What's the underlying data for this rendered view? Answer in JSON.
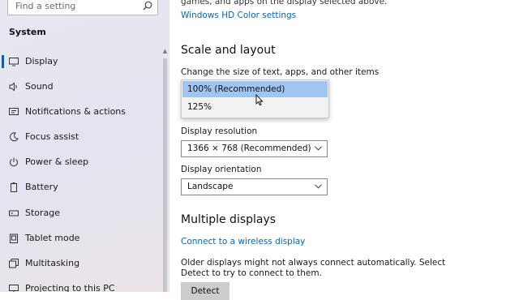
{
  "sidebar": {
    "search_placeholder": "Find a setting",
    "section_title": "System",
    "items": [
      {
        "label": "Display",
        "icon": "monitor-icon"
      },
      {
        "label": "Sound",
        "icon": "speaker-icon"
      },
      {
        "label": "Notifications & actions",
        "icon": "notifications-icon"
      },
      {
        "label": "Focus assist",
        "icon": "moon-icon"
      },
      {
        "label": "Power & sleep",
        "icon": "power-icon"
      },
      {
        "label": "Battery",
        "icon": "battery-icon"
      },
      {
        "label": "Storage",
        "icon": "storage-icon"
      },
      {
        "label": "Tablet mode",
        "icon": "tablet-icon"
      },
      {
        "label": "Multitasking",
        "icon": "multitasking-icon"
      },
      {
        "label": "Projecting to this PC",
        "icon": "projecting-icon"
      }
    ],
    "active_index": 0
  },
  "main": {
    "top_text": "games, and apps on the display selected above.",
    "hd_color_link": "Windows HD Color settings",
    "scale_heading": "Scale and layout",
    "scale_label": "Change the size of text, apps, and other items",
    "scale_options": [
      "100% (Recommended)",
      "125%"
    ],
    "scale_selected": "100% (Recommended)",
    "resolution_label": "Display resolution",
    "resolution_value": "1366 × 768 (Recommended)",
    "orientation_label": "Display orientation",
    "orientation_value": "Landscape",
    "multiple_heading": "Multiple displays",
    "wireless_link": "Connect to a wireless display",
    "older_text_line1": "Older displays might not always connect automatically. Select",
    "older_text_line2": "Detect to try to connect to them.",
    "detect_button": "Detect"
  },
  "colors": {
    "accent": "#0067c0",
    "selected_option": "#9ec6f0",
    "active_indicator": "#0e5ca8"
  }
}
